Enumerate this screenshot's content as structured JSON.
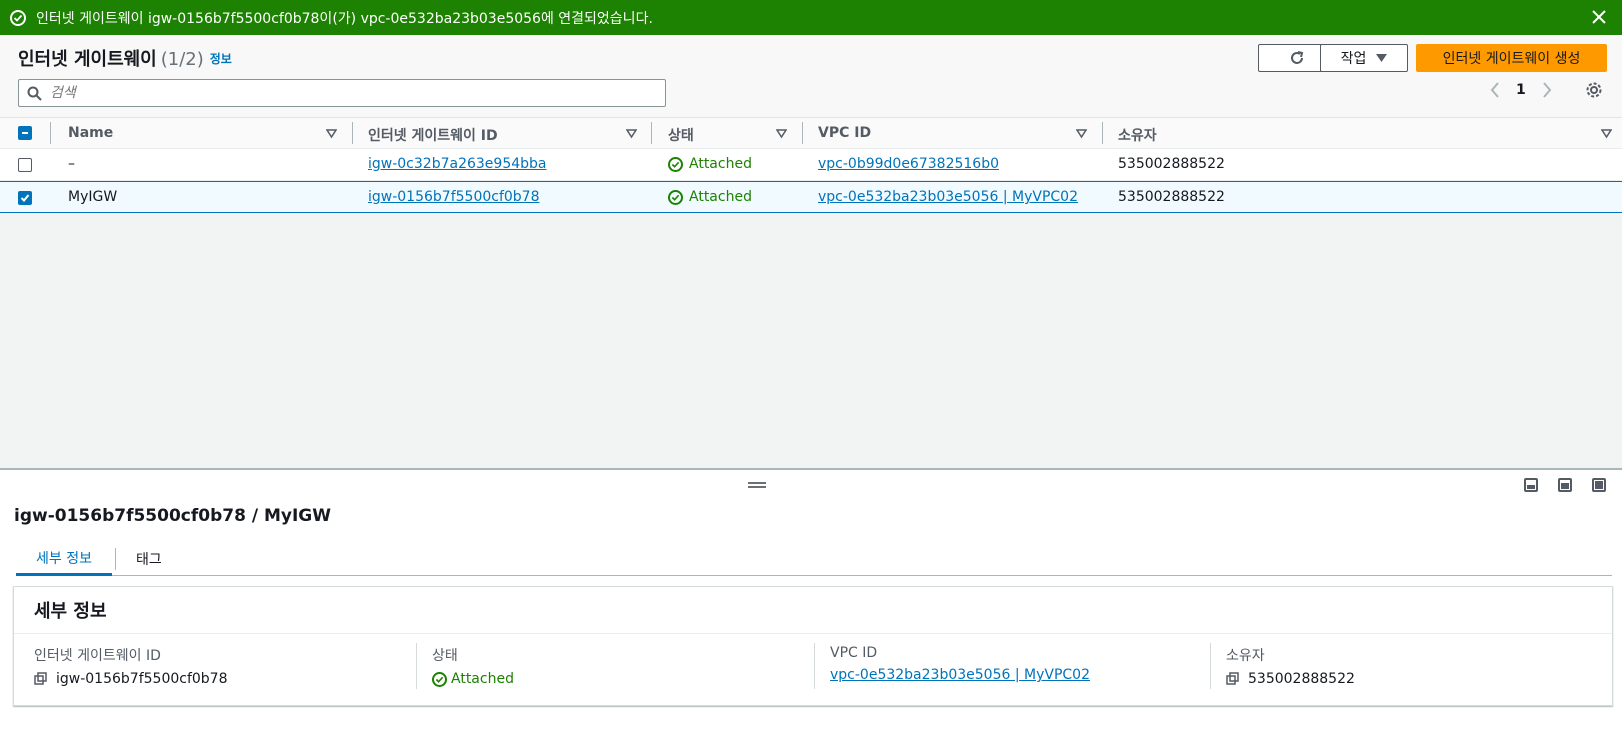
{
  "flash": {
    "message": "인터넷 게이트웨이 igw-0156b7f5500cf0b78이(가) vpc-0e532ba23b03e5056에 연결되었습니다."
  },
  "header": {
    "title": "인터넷 게이트웨이",
    "count": "(1/2)",
    "info": "정보",
    "actions_label": "작업",
    "create_label": "인터넷 게이트웨이 생성"
  },
  "search": {
    "placeholder": "검색"
  },
  "pagination": {
    "page": "1"
  },
  "table": {
    "columns": [
      "Name",
      "인터넷 게이트웨이 ID",
      "상태",
      "VPC ID",
      "소유자"
    ],
    "rows": [
      {
        "selected": false,
        "name": "–",
        "igw_id": "igw-0c32b7a263e954bba",
        "status": "Attached",
        "vpc_id": "vpc-0b99d0e67382516b0",
        "owner": "535002888522"
      },
      {
        "selected": true,
        "name": "MyIGW",
        "igw_id": "igw-0156b7f5500cf0b78",
        "status": "Attached",
        "vpc_id": "vpc-0e532ba23b03e5056 | MyVPC02",
        "owner": "535002888522"
      }
    ]
  },
  "detail": {
    "title": "igw-0156b7f5500cf0b78 / MyIGW",
    "tabs": [
      "세부 정보",
      "태그"
    ],
    "panel_title": "세부 정보",
    "fields": [
      {
        "label": "인터넷 게이트웨이 ID",
        "value": "igw-0156b7f5500cf0b78"
      },
      {
        "label": "상태",
        "value": "Attached"
      },
      {
        "label": "VPC ID",
        "value": "vpc-0e532ba23b03e5056 | MyVPC02"
      },
      {
        "label": "소유자",
        "value": "535002888522"
      }
    ]
  },
  "colors": {
    "success": "#1d8102",
    "link": "#0073bb",
    "primary": "#ff9900"
  }
}
